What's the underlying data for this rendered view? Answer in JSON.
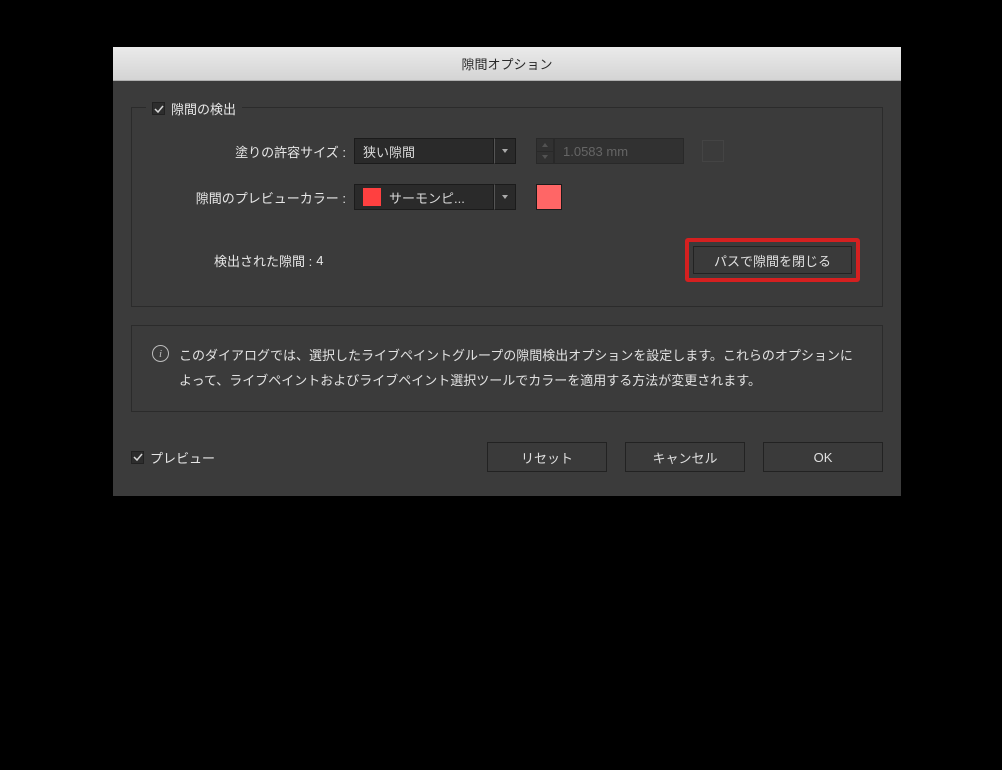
{
  "dialog": {
    "title": "隙間オプション"
  },
  "detect": {
    "legend": "隙間の検出",
    "legend_checked": true,
    "tolerance_label": "塗りの許容サイズ :",
    "tolerance_value": "狭い隙間",
    "custom_value": "1.0583 mm",
    "preview_color_label": "隙間のプレビューカラー :",
    "preview_color_name": "サーモンピ...",
    "preview_color_hex": "#ff6666",
    "detected_label": "検出された隙間 :",
    "detected_count": "4",
    "close_btn": "パスで隙間を閉じる"
  },
  "info": {
    "text": "このダイアログでは、選択したライブペイントグループの隙間検出オプションを設定します。これらのオプションによって、ライブペイントおよびライブペイント選択ツールでカラーを適用する方法が変更されます。"
  },
  "footer": {
    "preview": "プレビュー",
    "reset": "リセット",
    "cancel": "キャンセル",
    "ok": "OK"
  },
  "colors": {
    "highlight": "#d42020"
  }
}
